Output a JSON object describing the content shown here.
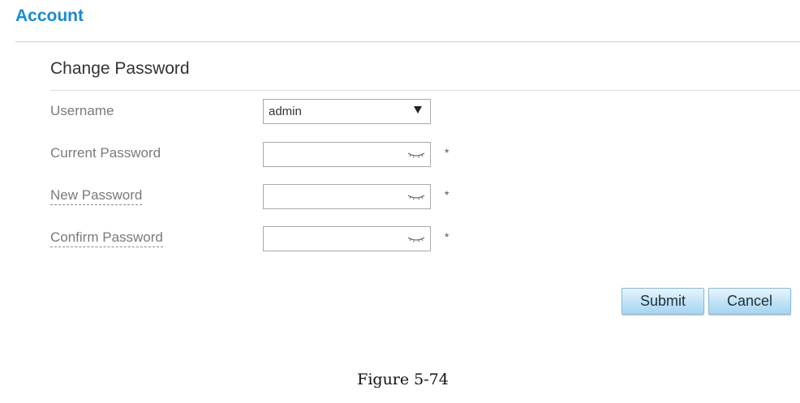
{
  "header": {
    "title": "Account"
  },
  "section": {
    "title": "Change Password"
  },
  "form": {
    "username": {
      "label": "Username",
      "selected": "admin"
    },
    "current_password": {
      "label": "Current Password",
      "value": "",
      "required_marker": "*"
    },
    "new_password": {
      "label": "New Password",
      "value": "",
      "required_marker": "*"
    },
    "confirm_password": {
      "label": "Confirm Password",
      "value": "",
      "required_marker": "*"
    }
  },
  "buttons": {
    "submit_label": "Submit",
    "cancel_label": "Cancel"
  },
  "caption": {
    "text": "Figure 5-74"
  },
  "icons": {
    "dropdown": "chevron-down-icon",
    "password_visibility": "eye-closed-icon"
  },
  "colors": {
    "title_blue": "#1a8ad0",
    "button_fill": "#bfe2f6"
  }
}
